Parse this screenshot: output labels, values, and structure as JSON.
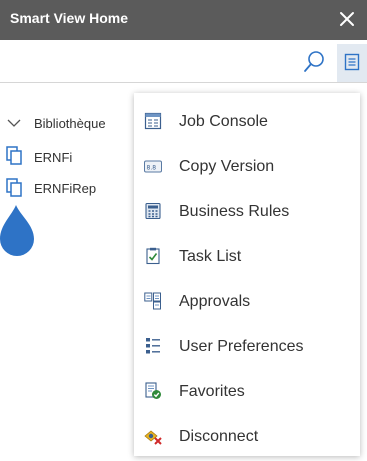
{
  "window": {
    "title": "Smart View Home"
  },
  "tree": {
    "root_label": "Bibliothèque",
    "items": [
      {
        "label": "ERNFi"
      },
      {
        "label": "ERNFiRep"
      }
    ]
  },
  "menu": {
    "items": [
      {
        "label": "Job Console",
        "icon": "job-console-icon"
      },
      {
        "label": "Copy Version",
        "icon": "copy-version-icon"
      },
      {
        "label": "Business Rules",
        "icon": "business-rules-icon"
      },
      {
        "label": "Task List",
        "icon": "task-list-icon"
      },
      {
        "label": "Approvals",
        "icon": "approvals-icon"
      },
      {
        "label": "User Preferences",
        "icon": "user-preferences-icon"
      },
      {
        "label": "Favorites",
        "icon": "favorites-icon"
      },
      {
        "label": "Disconnect",
        "icon": "disconnect-icon"
      }
    ]
  },
  "colors": {
    "titlebar": "#5b5b5b",
    "accent": "#2e73c6",
    "menu_button_bg": "#e2e9f1"
  }
}
